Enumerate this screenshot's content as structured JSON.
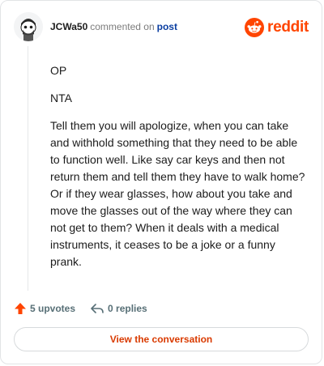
{
  "comment": {
    "username": "JCWa50",
    "action_text": "commented on",
    "target_text": "post",
    "paragraphs": [
      "OP",
      "NTA",
      "Tell them you will apologize, when you can take and withhold something that they need to be able to function well. Like say car keys and then not return them and tell them they have to walk home? Or if they wear glasses, how about you take and move the glasses out of the way where they can not get to them? When it deals with a medical instruments, it ceases to be a joke or a funny prank."
    ],
    "upvotes_label": "5 upvotes",
    "replies_label": "0 replies"
  },
  "brand": {
    "wordmark": "reddit",
    "icon": "reddit-snoo-icon",
    "color": "#ff4500"
  },
  "cta": {
    "label": "View the conversation",
    "color": "#d93a00"
  },
  "icons": {
    "upvote": "upvote-arrow-icon",
    "reply": "reply-arrow-icon",
    "avatar": "avatar-icon"
  }
}
